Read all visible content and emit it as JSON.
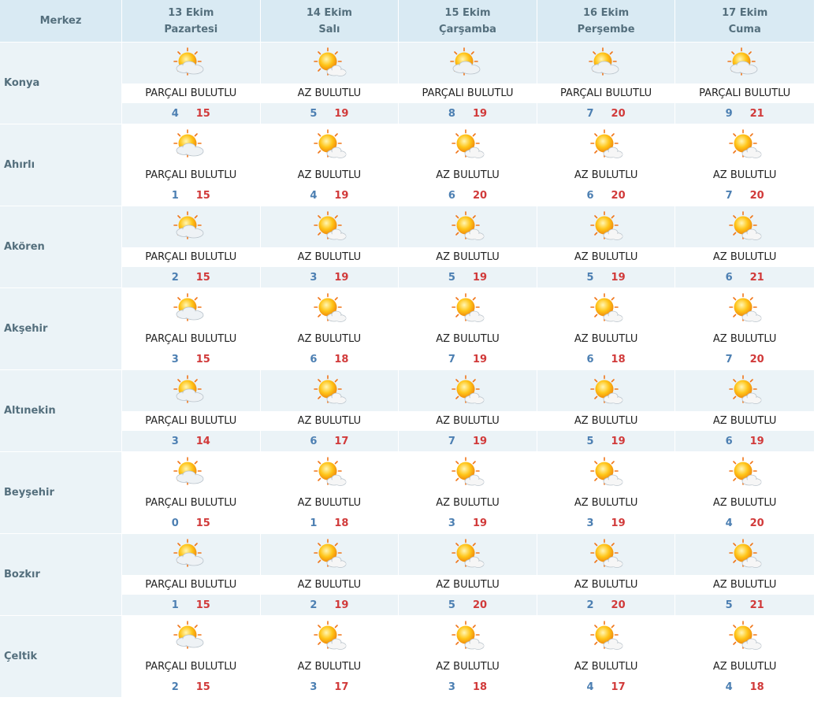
{
  "header": {
    "city_column": "Merkez",
    "days": [
      {
        "date": "13 Ekim",
        "weekday": "Pazartesi"
      },
      {
        "date": "14 Ekim",
        "weekday": "Salı"
      },
      {
        "date": "15 Ekim",
        "weekday": "Çarşamba"
      },
      {
        "date": "16 Ekim",
        "weekday": "Perşembe"
      },
      {
        "date": "17 Ekim",
        "weekday": "Cuma"
      }
    ]
  },
  "colors": {
    "min_temp": "#4c7fb2",
    "max_temp": "#d13a3a",
    "header_bg": "#d9eaf3",
    "shaded_bg": "#ebf3f7"
  },
  "rows": [
    {
      "city": "Konya",
      "days": [
        {
          "icon": "partly-cloudy-icon",
          "desc": "PARÇALI BULUTLU",
          "min": "4",
          "max": "15"
        },
        {
          "icon": "mostly-sunny-icon",
          "desc": "AZ BULUTLU",
          "min": "5",
          "max": "19"
        },
        {
          "icon": "partly-cloudy-icon",
          "desc": "PARÇALI BULUTLU",
          "min": "8",
          "max": "19"
        },
        {
          "icon": "partly-cloudy-icon",
          "desc": "PARÇALI BULUTLU",
          "min": "7",
          "max": "20"
        },
        {
          "icon": "partly-cloudy-icon",
          "desc": "PARÇALI BULUTLU",
          "min": "9",
          "max": "21"
        }
      ]
    },
    {
      "city": "Ahırlı",
      "days": [
        {
          "icon": "partly-cloudy-icon",
          "desc": "PARÇALI BULUTLU",
          "min": "1",
          "max": "15"
        },
        {
          "icon": "mostly-sunny-icon",
          "desc": "AZ BULUTLU",
          "min": "4",
          "max": "19"
        },
        {
          "icon": "mostly-sunny-icon",
          "desc": "AZ BULUTLU",
          "min": "6",
          "max": "20"
        },
        {
          "icon": "mostly-sunny-icon",
          "desc": "AZ BULUTLU",
          "min": "6",
          "max": "20"
        },
        {
          "icon": "mostly-sunny-icon",
          "desc": "AZ BULUTLU",
          "min": "7",
          "max": "20"
        }
      ]
    },
    {
      "city": "Akören",
      "days": [
        {
          "icon": "partly-cloudy-icon",
          "desc": "PARÇALI BULUTLU",
          "min": "2",
          "max": "15"
        },
        {
          "icon": "mostly-sunny-icon",
          "desc": "AZ BULUTLU",
          "min": "3",
          "max": "19"
        },
        {
          "icon": "mostly-sunny-icon",
          "desc": "AZ BULUTLU",
          "min": "5",
          "max": "19"
        },
        {
          "icon": "mostly-sunny-icon",
          "desc": "AZ BULUTLU",
          "min": "5",
          "max": "19"
        },
        {
          "icon": "mostly-sunny-icon",
          "desc": "AZ BULUTLU",
          "min": "6",
          "max": "21"
        }
      ]
    },
    {
      "city": "Akşehir",
      "days": [
        {
          "icon": "partly-cloudy-icon",
          "desc": "PARÇALI BULUTLU",
          "min": "3",
          "max": "15"
        },
        {
          "icon": "mostly-sunny-icon",
          "desc": "AZ BULUTLU",
          "min": "6",
          "max": "18"
        },
        {
          "icon": "mostly-sunny-icon",
          "desc": "AZ BULUTLU",
          "min": "7",
          "max": "19"
        },
        {
          "icon": "mostly-sunny-icon",
          "desc": "AZ BULUTLU",
          "min": "6",
          "max": "18"
        },
        {
          "icon": "mostly-sunny-icon",
          "desc": "AZ BULUTLU",
          "min": "7",
          "max": "20"
        }
      ]
    },
    {
      "city": "Altınekin",
      "days": [
        {
          "icon": "partly-cloudy-icon",
          "desc": "PARÇALI BULUTLU",
          "min": "3",
          "max": "14"
        },
        {
          "icon": "mostly-sunny-icon",
          "desc": "AZ BULUTLU",
          "min": "6",
          "max": "17"
        },
        {
          "icon": "mostly-sunny-icon",
          "desc": "AZ BULUTLU",
          "min": "7",
          "max": "19"
        },
        {
          "icon": "mostly-sunny-icon",
          "desc": "AZ BULUTLU",
          "min": "5",
          "max": "19"
        },
        {
          "icon": "mostly-sunny-icon",
          "desc": "AZ BULUTLU",
          "min": "6",
          "max": "19"
        }
      ]
    },
    {
      "city": "Beyşehir",
      "days": [
        {
          "icon": "partly-cloudy-icon",
          "desc": "PARÇALI BULUTLU",
          "min": "0",
          "max": "15"
        },
        {
          "icon": "mostly-sunny-icon",
          "desc": "AZ BULUTLU",
          "min": "1",
          "max": "18"
        },
        {
          "icon": "mostly-sunny-icon",
          "desc": "AZ BULUTLU",
          "min": "3",
          "max": "19"
        },
        {
          "icon": "mostly-sunny-icon",
          "desc": "AZ BULUTLU",
          "min": "3",
          "max": "19"
        },
        {
          "icon": "mostly-sunny-icon",
          "desc": "AZ BULUTLU",
          "min": "4",
          "max": "20"
        }
      ]
    },
    {
      "city": "Bozkır",
      "days": [
        {
          "icon": "partly-cloudy-icon",
          "desc": "PARÇALI BULUTLU",
          "min": "1",
          "max": "15"
        },
        {
          "icon": "mostly-sunny-icon",
          "desc": "AZ BULUTLU",
          "min": "2",
          "max": "19"
        },
        {
          "icon": "mostly-sunny-icon",
          "desc": "AZ BULUTLU",
          "min": "5",
          "max": "20"
        },
        {
          "icon": "mostly-sunny-icon",
          "desc": "AZ BULUTLU",
          "min": "2",
          "max": "20"
        },
        {
          "icon": "mostly-sunny-icon",
          "desc": "AZ BULUTLU",
          "min": "5",
          "max": "21"
        }
      ]
    },
    {
      "city": "Çeltik",
      "days": [
        {
          "icon": "partly-cloudy-icon",
          "desc": "PARÇALI BULUTLU",
          "min": "2",
          "max": "15"
        },
        {
          "icon": "mostly-sunny-icon",
          "desc": "AZ BULUTLU",
          "min": "3",
          "max": "17"
        },
        {
          "icon": "mostly-sunny-icon",
          "desc": "AZ BULUTLU",
          "min": "3",
          "max": "18"
        },
        {
          "icon": "mostly-sunny-icon",
          "desc": "AZ BULUTLU",
          "min": "4",
          "max": "17"
        },
        {
          "icon": "mostly-sunny-icon",
          "desc": "AZ BULUTLU",
          "min": "4",
          "max": "18"
        }
      ]
    }
  ]
}
